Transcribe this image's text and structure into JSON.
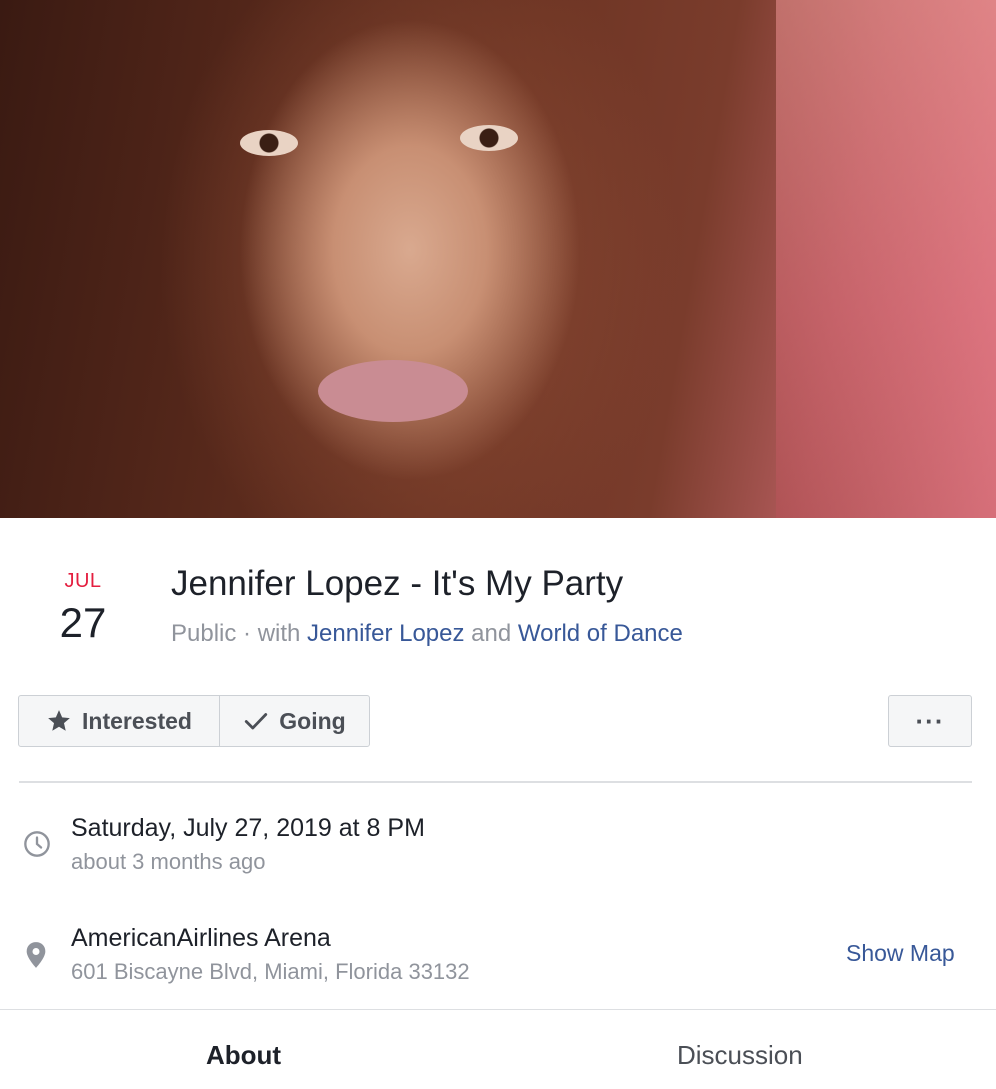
{
  "event": {
    "month": "JUL",
    "day": "27",
    "title": "Jennifer Lopez - It's My Party",
    "privacy": "Public · with ",
    "host_1": "Jennifer Lopez",
    "joiner": " and ",
    "host_2": "World of Dance"
  },
  "actions": {
    "interested_label": "Interested",
    "going_label": "Going",
    "more_label": "···"
  },
  "details": {
    "datetime": "Saturday, July 27, 2019 at 8 PM",
    "relative_time": "about 3 months ago",
    "venue": "AmericanAirlines Arena",
    "address": "601 Biscayne Blvd, Miami, Florida 33132",
    "show_map_label": "Show Map"
  },
  "tabs": [
    {
      "label": "About",
      "active": true
    },
    {
      "label": "Discussion",
      "active": false
    }
  ],
  "icons": {
    "star": "star-icon",
    "check": "check-icon",
    "clock": "clock-icon",
    "pin": "location-pin-icon"
  },
  "colors": {
    "accent_red": "#e41e3f",
    "link_blue": "#385898",
    "muted_gray": "#90949c"
  }
}
